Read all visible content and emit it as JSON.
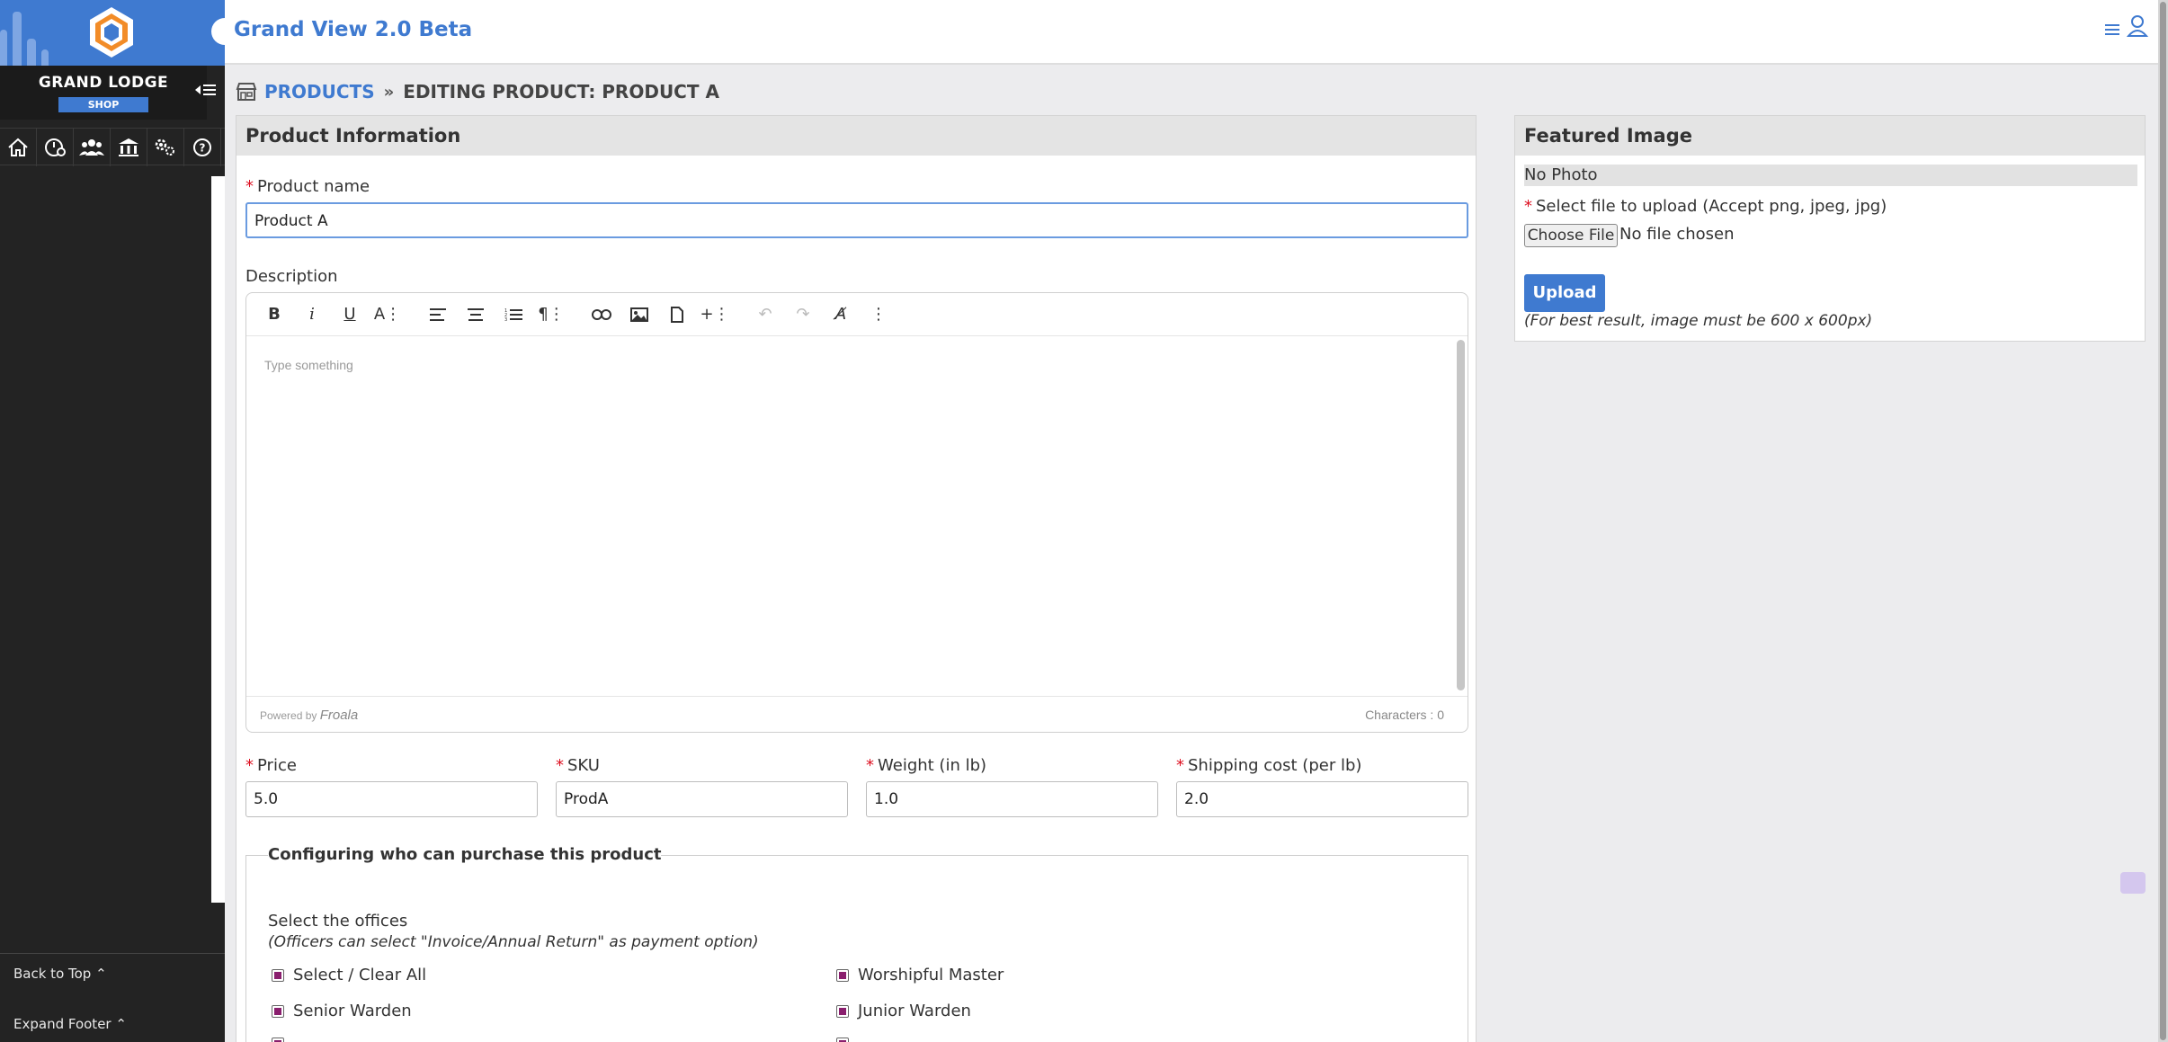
{
  "sidebar": {
    "brand_name": "GRAND LODGE",
    "brand_sub": "SHOP",
    "icons": [
      "home-icon",
      "dashboard-gauge-icon",
      "members-icon",
      "lodge-building-icon",
      "settings-gears-icon",
      "help-icon"
    ],
    "back_to_top": "Back to Top ⌃",
    "expand_footer": "Expand Footer ⌃"
  },
  "header": {
    "title": "Grand View 2.0 Beta"
  },
  "breadcrumb": {
    "link": "PRODUCTS",
    "current": "EDITING PRODUCT: PRODUCT A"
  },
  "product_info": {
    "heading": "Product Information",
    "name_label": "Product name",
    "name_value": "Product A",
    "description_label": "Description",
    "editor": {
      "placeholder": "Type something",
      "powered_by": "Powered by",
      "brand": "Froala",
      "char_count": "Characters : 0"
    },
    "price_label": "Price",
    "price_value": "5.0",
    "sku_label": "SKU",
    "sku_value": "ProdA",
    "weight_label": "Weight (in lb)",
    "weight_value": "1.0",
    "shipping_label": "Shipping cost (per lb)",
    "shipping_value": "2.0"
  },
  "purchase_config": {
    "legend": "Configuring who can purchase this product",
    "title": "Select the offices",
    "note": "(Officers can select \"Invoice/Annual Return\" as payment option)",
    "options": [
      {
        "label": "Select / Clear All",
        "checked": true
      },
      {
        "label": "Worshipful Master",
        "checked": true
      },
      {
        "label": "Senior Warden",
        "checked": true
      },
      {
        "label": "Junior Warden",
        "checked": true
      }
    ]
  },
  "featured": {
    "heading": "Featured Image",
    "no_photo": "No Photo",
    "select_label": "Select file to upload (Accept png, jpeg, jpg)",
    "choose_file": "Choose File",
    "no_file": "No file chosen",
    "upload": "Upload",
    "hint": "(For best result, image must be 600 x 600px)"
  },
  "colors": {
    "brand_blue": "#3f7ad0",
    "sidebar_dark": "#232323",
    "required_red": "#dd1122",
    "checkbox_purple": "#8a1f6e"
  }
}
